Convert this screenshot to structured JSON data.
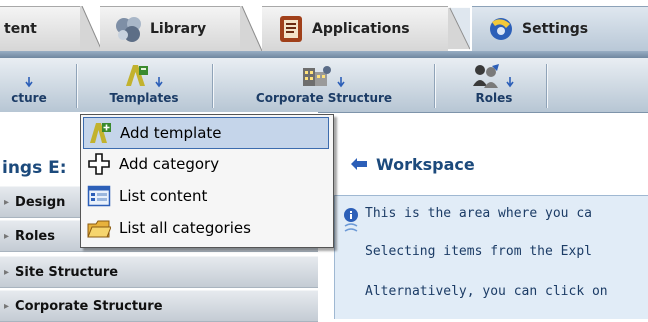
{
  "tabs": [
    {
      "label": "tent",
      "icon": "content-icon"
    },
    {
      "label": "Library",
      "icon": "library-icon"
    },
    {
      "label": "Applications",
      "icon": "applications-icon"
    },
    {
      "label": "Settings",
      "icon": "settings-icon"
    }
  ],
  "toolbar": {
    "items": [
      {
        "label": "cture",
        "icon": "site-structure-icon"
      },
      {
        "label": "Templates",
        "icon": "templates-icon"
      },
      {
        "label": "Corporate Structure",
        "icon": "corporate-structure-icon"
      },
      {
        "label": "Roles",
        "icon": "roles-icon"
      }
    ]
  },
  "menu": {
    "items": [
      {
        "label": "Add template",
        "icon": "add-template-icon"
      },
      {
        "label": "Add category",
        "icon": "add-category-icon"
      },
      {
        "label": "List content",
        "icon": "list-content-icon"
      },
      {
        "label": "List all categories",
        "icon": "list-categories-icon"
      }
    ]
  },
  "left_panel": {
    "title": "ings E:",
    "items": [
      {
        "label": "Design"
      },
      {
        "label": "Roles"
      },
      {
        "label": "Site Structure"
      },
      {
        "label": "Corporate Structure"
      }
    ]
  },
  "workspace": {
    "title": "Workspace",
    "lines": [
      "This is the area where you ca",
      "Selecting items from the Expl",
      "Alternatively, you can click on"
    ]
  },
  "colors": {
    "accent": "#1c4a7c",
    "toolbar_label": "#1c3c66",
    "menu_highlight": "#c5d5ea",
    "info_background": "#e1ecf7"
  }
}
